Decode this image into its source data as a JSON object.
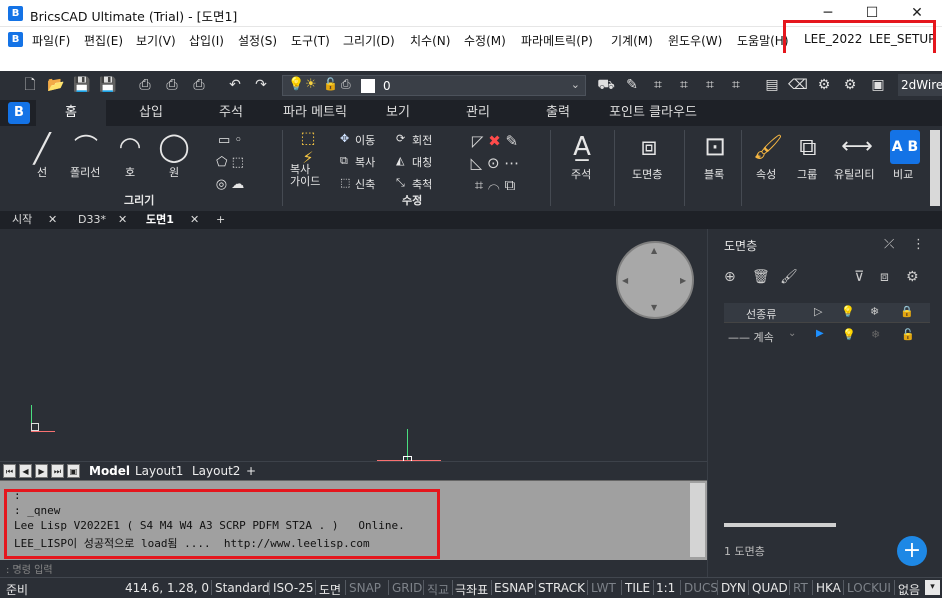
{
  "window": {
    "title": "BricsCAD Ultimate (Trial) - [도면1]",
    "logo": "B"
  },
  "menu": [
    "파일(F)",
    "편집(E)",
    "보기(V)",
    "삽입(I)",
    "설정(S)",
    "도구(T)",
    "그리기(D)",
    "치수(N)",
    "수정(M)",
    "파라메트릭(P)",
    "기계(M)",
    "윈도우(W)",
    "도움말(H)",
    "LEE_2022",
    "LEE_SETUP"
  ],
  "toolbar": {
    "layer_name": "0",
    "workspace": "2dWire"
  },
  "ribbon_tabs": [
    "홈",
    "삽입",
    "주석",
    "파라 메트릭",
    "보기",
    "관리",
    "출력",
    "포인트 클라우드"
  ],
  "ribbon": {
    "draw_group": "그리기",
    "modify_group": "수정",
    "line": "선",
    "polyline": "폴리선",
    "arc": "호",
    "circle": "원",
    "copy_guide": "복사\n가이드",
    "move": "이동",
    "copy": "복사",
    "stretch": "신축",
    "rotate": "회전",
    "mirror": "대칭",
    "scale": "축척",
    "annotate": "주석",
    "layers": "도면층",
    "block": "블록",
    "properties": "속성",
    "groups": "그룹",
    "utilities": "유틸리티",
    "compare": "비교"
  },
  "doc_tabs": [
    "시작",
    "D33*",
    "도면1"
  ],
  "layout_tabs": [
    "Model",
    "Layout1",
    "Layout2"
  ],
  "command_lines": [
    ":",
    ": _qnew",
    "Lee Lisp V2022E1 ( S4 M4 W4 A3 SCRP PDFM ST2A . )   Online.",
    "LEE_LISP이 성공적으로 load됨 ....  http://www.leelisp.com"
  ],
  "command_prompt": ": 명령 입력",
  "panel": {
    "title": "도면층",
    "col_linetype": "선종류",
    "row_linetype": "—— 계속",
    "footer": "1 도면층"
  },
  "status": {
    "ready": "준비",
    "coords": "414.6, 1.28, 0",
    "items": [
      "Standard",
      "ISO-25",
      "도면",
      "SNAP",
      "GRID",
      "직교",
      "극좌표",
      "ESNAP",
      "STRACK",
      "LWT",
      "TILE",
      "1:1",
      "DUCS",
      "DYN",
      "QUAD",
      "RT",
      "HKA",
      "LOCKUI",
      "없음"
    ]
  },
  "colors": {
    "accent": "#1473e6",
    "highlight": "#e5161d",
    "background": "#2b2f36"
  }
}
